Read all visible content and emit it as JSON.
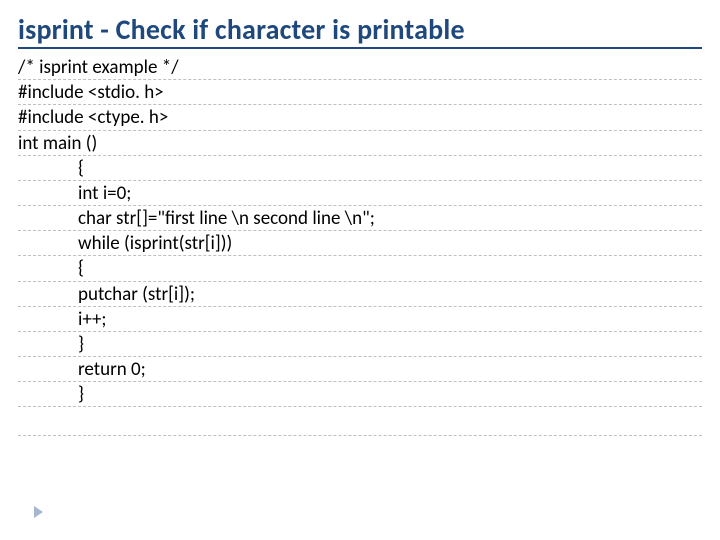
{
  "title": "isprint - Check if character is printable",
  "code": {
    "l0": "/* isprint example */",
    "l1": "#include <stdio. h>",
    "l2": "#include <ctype. h>",
    "l3": "int main ()",
    "l4": "{",
    "l5": "int i=0;",
    "l6": "char str[]=\"first line \\n second line \\n\";",
    "l7": "while (isprint(str[i]))",
    "l8": "{",
    "l9": "putchar (str[i]);",
    "l10": "i++;",
    "l11": "}",
    "l12": "return 0;",
    "l13": "}"
  }
}
